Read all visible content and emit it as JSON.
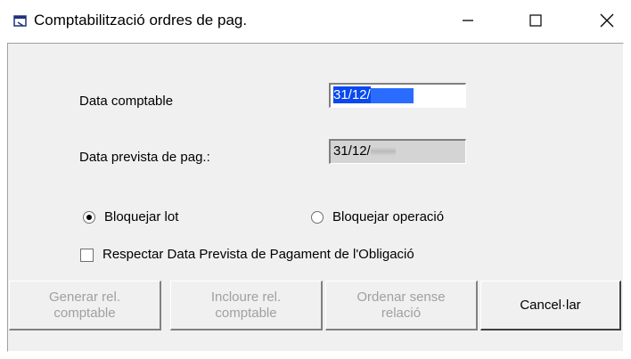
{
  "window": {
    "title": "Comptabilització ordres de pag.",
    "icons": {
      "app": "app-window-icon",
      "minimize": "minimize-icon",
      "maximize": "maximize-icon",
      "close": "close-icon"
    }
  },
  "form": {
    "data_comptable_label": "Data comptable",
    "data_comptable_value": "31/12/",
    "data_prevista_label": "Data prevista de pag.:",
    "data_prevista_value": "31/12/",
    "radio_lot_label": "Bloquejar lot",
    "radio_lot_selected": true,
    "radio_operacio_label": "Bloquejar operació",
    "radio_operacio_selected": false,
    "checkbox_label": "Respectar Data Prevista de Pagament de l'Obligació",
    "checkbox_checked": false
  },
  "buttons": {
    "generar": "Generar rel.\ncomptable",
    "incloure": "Incloure rel.\ncomptable",
    "ordenar": "Ordenar sense\nrelació",
    "cancelar": "Cancel·lar"
  },
  "colors": {
    "selection": "#0a48f0",
    "client_bg": "#f0f0f0",
    "disabled_text": "#a0a0a0"
  }
}
